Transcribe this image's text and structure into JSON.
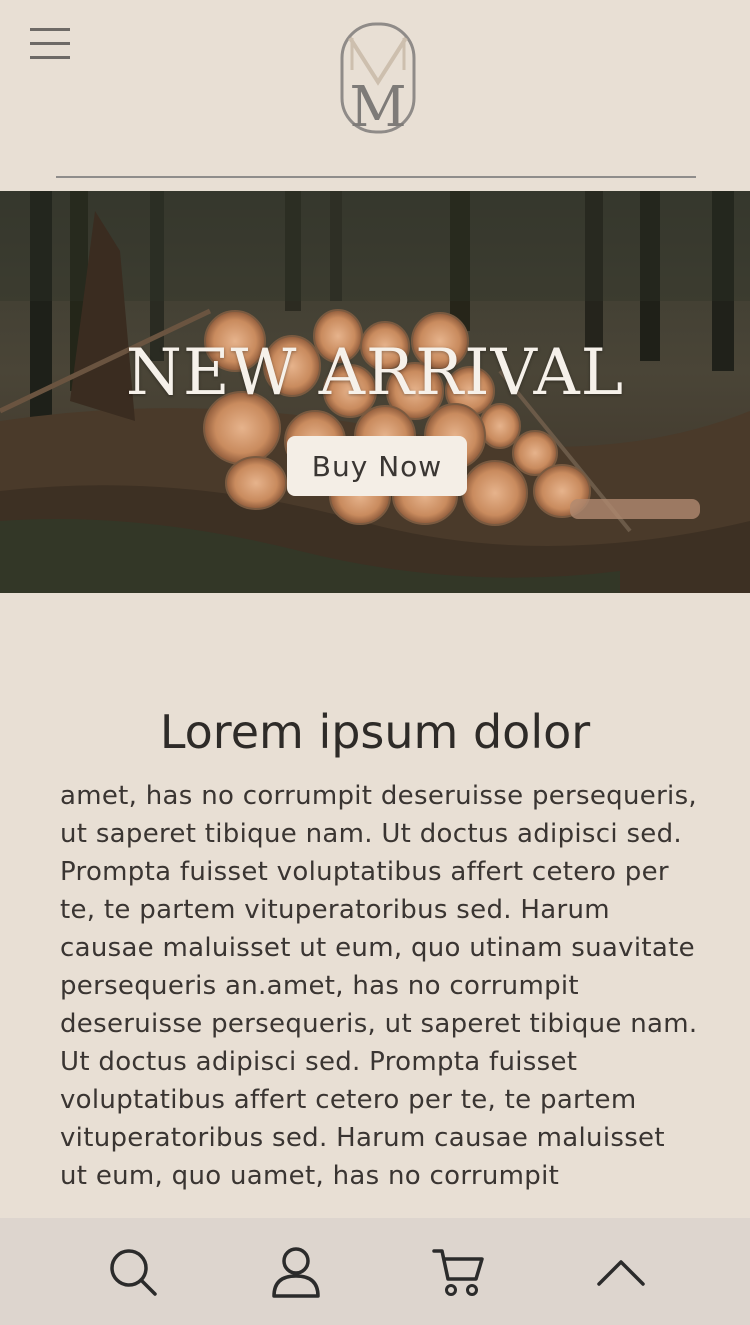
{
  "header": {
    "logo_letter": "M",
    "menu_icon": "hamburger-menu-icon"
  },
  "hero": {
    "title": "NEW ARRIVAL",
    "button_label": "Buy Now"
  },
  "content": {
    "title": "Lorem ipsum dolor",
    "body": "amet, has no corrumpit deseruisse persequeris, ut saperet tibique nam. Ut doctus adipisci sed. Prompta fuisset voluptatibus affert cetero per te, te partem vituperatoribus sed. Harum causae maluisset ut eum, quo utinam suavitate persequeris an.amet, has no corrumpit deseruisse persequeris, ut saperet tibique nam. Ut doctus adipisci sed. Prompta fuisset voluptatibus affert cetero per te, te partem vituperatoribus sed. Harum causae maluisset ut eum, quo uamet, has no corrumpit"
  },
  "bottom_nav": {
    "items": [
      {
        "icon": "search-icon"
      },
      {
        "icon": "user-icon"
      },
      {
        "icon": "cart-icon"
      },
      {
        "icon": "chevron-up-icon"
      }
    ]
  },
  "colors": {
    "background": "#e8dfd4",
    "nav_background": "#ddd5ce",
    "text": "#2e2b28",
    "button_background": "#f4eee6"
  }
}
